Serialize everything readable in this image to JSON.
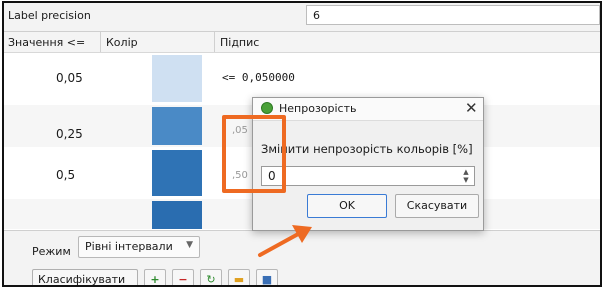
{
  "precision": {
    "label": "Label precision",
    "value": "6"
  },
  "table": {
    "headers": [
      "Значення <=",
      "Колір",
      "Підпис"
    ],
    "rows": [
      {
        "value": "0,05",
        "color": "#cfe0f2",
        "label": "<= 0,050000"
      },
      {
        "value": "0,25",
        "color": "#4a8ac6",
        "label": ""
      },
      {
        "value": "0,5",
        "color": "#2f73b5",
        "label": ""
      },
      {
        "value": "",
        "color": "#2a6db0",
        "label": ""
      }
    ],
    "behind_fragments": [
      ",05",
      ",50"
    ]
  },
  "mode": {
    "label": "Режим",
    "selected": "Рівні інтервали"
  },
  "toolbar": {
    "classify_label": "Класифікувати"
  },
  "dialog": {
    "title": "Непрозорість",
    "close": "✕",
    "prompt": "Змінити непрозорість кольорів [%]",
    "value": "0",
    "ok_label": "OK",
    "cancel_label": "Скасувати"
  },
  "colors": {
    "highlight": "#ee6a22",
    "arrow": "#ee6a22",
    "accent": "#3a7bd5"
  }
}
